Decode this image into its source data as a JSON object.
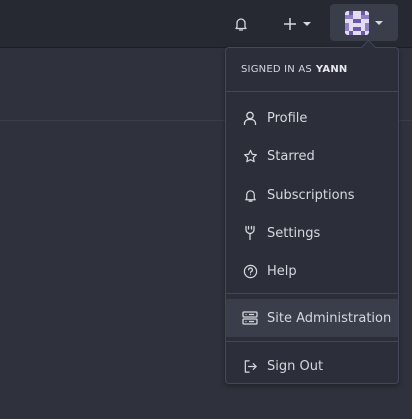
{
  "navbar": {
    "icons": {
      "notifications": "bell-icon",
      "create": "plus-icon",
      "avatar": "user-avatar"
    }
  },
  "dropdown": {
    "signed_in_prefix": "SIGNED IN AS",
    "username": "YANN",
    "items": [
      {
        "label": "Profile",
        "icon": "person-icon"
      },
      {
        "label": "Starred",
        "icon": "star-icon"
      },
      {
        "label": "Subscriptions",
        "icon": "bell-icon"
      },
      {
        "label": "Settings",
        "icon": "wrench-icon"
      },
      {
        "label": "Help",
        "icon": "question-icon"
      }
    ],
    "admin": {
      "label": "Site Administration",
      "icon": "server-icon"
    },
    "signout": {
      "label": "Sign Out",
      "icon": "sign-out-icon"
    }
  },
  "colors": {
    "background": "#2f323c",
    "navbar": "#262932",
    "dropdown": "#2c2f39",
    "hover": "#3a3e4a",
    "text": "#d6d8de"
  }
}
